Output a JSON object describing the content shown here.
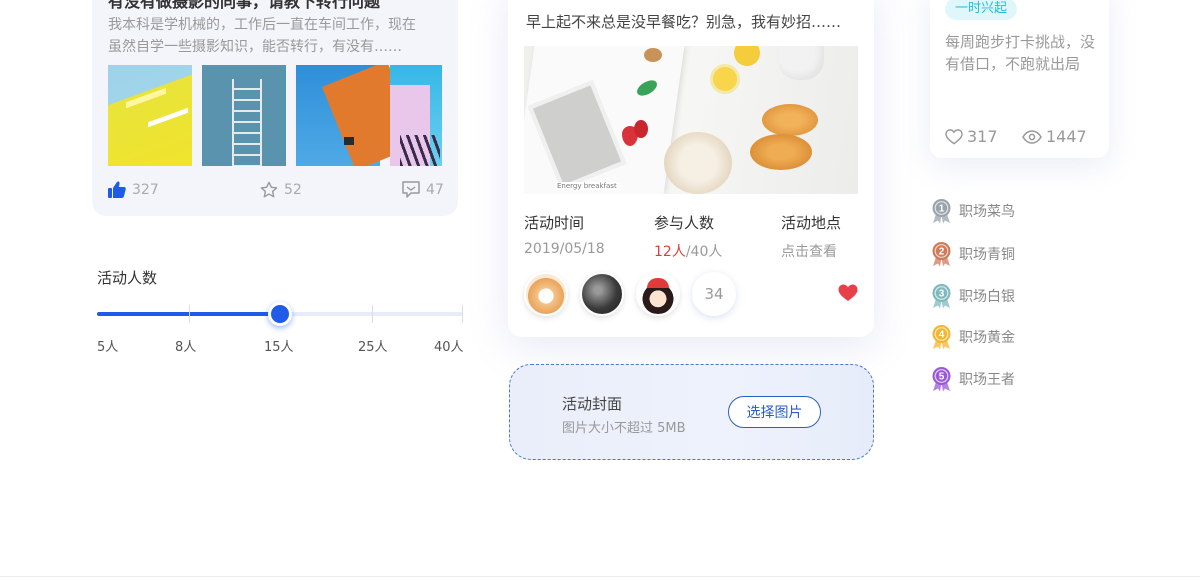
{
  "post": {
    "title": "有没有做摄影的同事，请教下转行问题",
    "body_lines": [
      "我本科是学机械的，工作后一直在车间工作，现在",
      "虽然自学一些摄影知识，能否转行，有没有……"
    ],
    "likes": "327",
    "stars": "52",
    "comments": "47",
    "accent_color": "#1f5ae8"
  },
  "slider": {
    "title": "活动人数",
    "labels": [
      "5人",
      "8人",
      "15人",
      "25人",
      "40人"
    ],
    "selected": "15人",
    "fill_fraction": 0.5
  },
  "event": {
    "description": "早上起不来总是没早餐吃？别急，我有妙招……",
    "image_caption": "Energy breakfast",
    "time_label": "活动时间",
    "time_value": "2019/05/18",
    "people_label": "参与人数",
    "people_current": "12人",
    "people_total": "/40人",
    "location_label": "活动地点",
    "location_value": "点击查看",
    "participant_count": "34",
    "highlight_color": "#e33b3b"
  },
  "upload": {
    "title": "活动封面",
    "hint": "图片大小不超过 5MB",
    "button_label": "选择图片"
  },
  "challenge": {
    "tag": "一时兴起",
    "desc_lines": [
      "每周跑步打卡挑战，没",
      "有借口，不跑就出局"
    ],
    "likes": "317",
    "views": "1447"
  },
  "ranks": [
    {
      "num": "1",
      "label": "职场菜鸟",
      "color": "#9aa3ad"
    },
    {
      "num": "2",
      "label": "职场青铜",
      "color": "#d07a5a"
    },
    {
      "num": "3",
      "label": "职场白银",
      "color": "#7fb9bd"
    },
    {
      "num": "4",
      "label": "职场黄金",
      "color": "#f2b630"
    },
    {
      "num": "5",
      "label": "职场王者",
      "color": "#9a5ad8"
    }
  ]
}
